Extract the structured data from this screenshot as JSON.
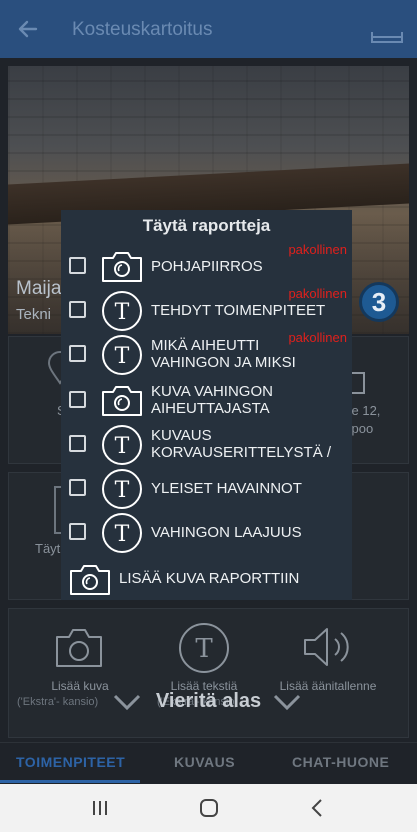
{
  "app_bar": {
    "title": "Kosteuskartoitus"
  },
  "hero": {
    "name": "Maija",
    "subtitle": "Tekni",
    "badge_count": "3"
  },
  "cards": {
    "card1_left": "S",
    "card1_right_line1": "tie 12,",
    "card1_right_line2": "spoo",
    "card2_left": "Täyt"
  },
  "actions": {
    "photo_label": "Lisää kuva",
    "photo_sublabel": "('Ekstra'- kansio)",
    "text_label": "Lisää tekstiä",
    "text_sublabel": "('Ekstra'- kansio)",
    "audio_label": "Lisää äänitallenne"
  },
  "scroll_hint": "Vieritä alas",
  "tabs": [
    "TOIMENPITEET",
    "KUVAUS",
    "CHAT-HUONE"
  ],
  "modal": {
    "title": "Täytä raportteja",
    "required_label": "pakollinen",
    "items": [
      {
        "icon": "camera-icon",
        "label": "POHJAPIIRROS",
        "required": true
      },
      {
        "icon": "text-icon",
        "label": "TEHDYT TOIMENPITEET",
        "required": true
      },
      {
        "icon": "text-icon",
        "label": "MIKÄ AIHEUTTI\nVAHINGON JA MIKSI",
        "required": true
      },
      {
        "icon": "camera-icon",
        "label": "KUVA VAHINGON\nAIHEUTTAJASTA",
        "required": false
      },
      {
        "icon": "text-icon",
        "label": "KUVAUS\nKORVAUSERITTELYSTÄ /",
        "required": false
      },
      {
        "icon": "text-icon",
        "label": "YLEISET HAVAINNOT",
        "required": false
      },
      {
        "icon": "text-icon",
        "label": "VAHINGON LAAJUUS",
        "required": false
      }
    ],
    "add_photo": "LISÄÄ KUVA RAPORTTIIN"
  },
  "colors": {
    "app_bar": "#2a4f7e",
    "modal_bg": "#26313d",
    "required_red": "#e0201c",
    "active_tab": "#2d63a6"
  }
}
